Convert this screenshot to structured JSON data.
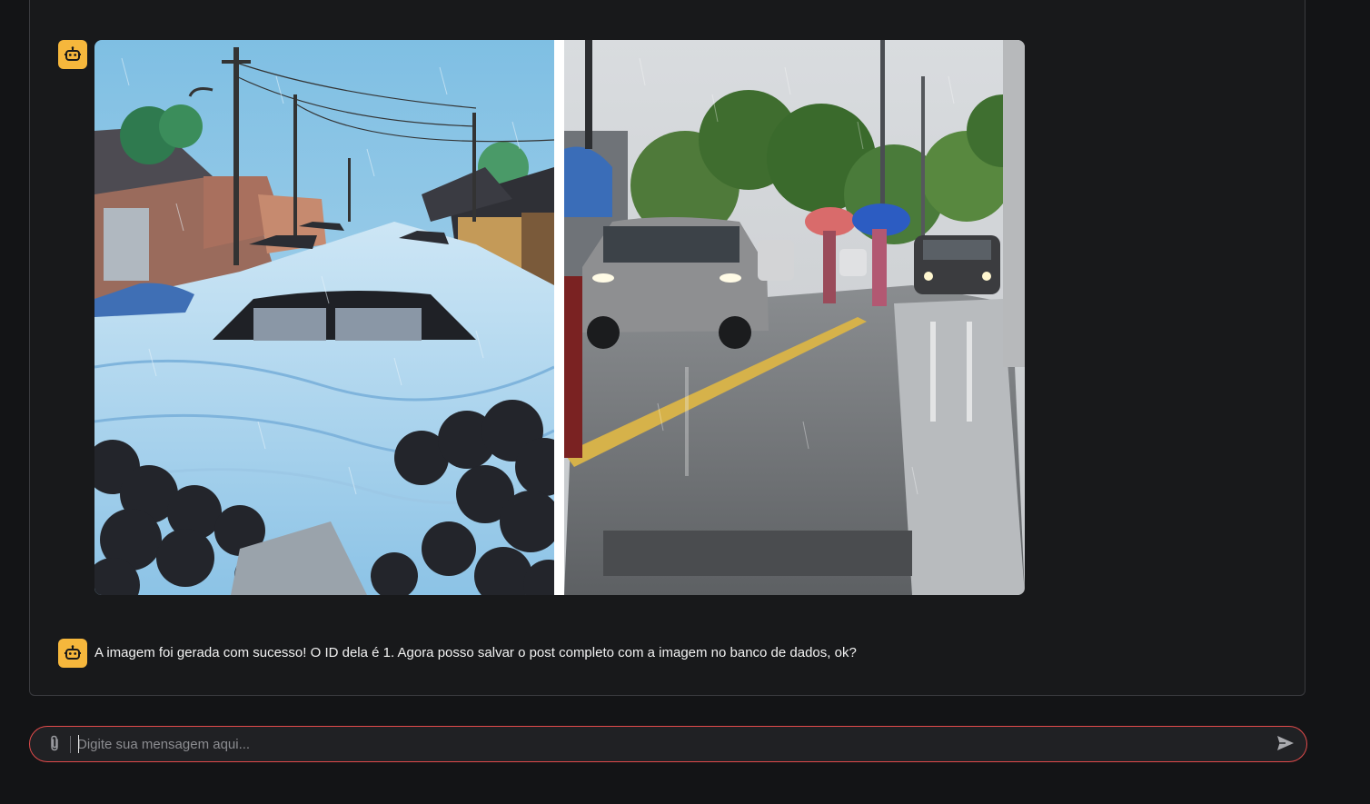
{
  "messages": [
    {
      "role": "assistant",
      "avatar_icon": "robot-icon",
      "type": "image",
      "image": {
        "left_panel": "illustration: flooded street with submerged cars and garbage bags",
        "right_panel": "photo: rainy street with cars and people with umbrellas"
      }
    },
    {
      "role": "assistant",
      "avatar_icon": "robot-icon",
      "type": "text",
      "text": "A imagem foi gerada com sucesso! O ID dela é 1. Agora posso salvar o post completo com a imagem no banco de dados, ok?"
    }
  ],
  "composer": {
    "placeholder": "Digite sua mensagem aqui...",
    "value": "",
    "attach_icon": "paperclip-icon",
    "send_icon": "send-icon"
  },
  "colors": {
    "background": "#131416",
    "panel": "#18191b",
    "avatar": "#f6b73c",
    "input_border": "#e24b4b"
  }
}
